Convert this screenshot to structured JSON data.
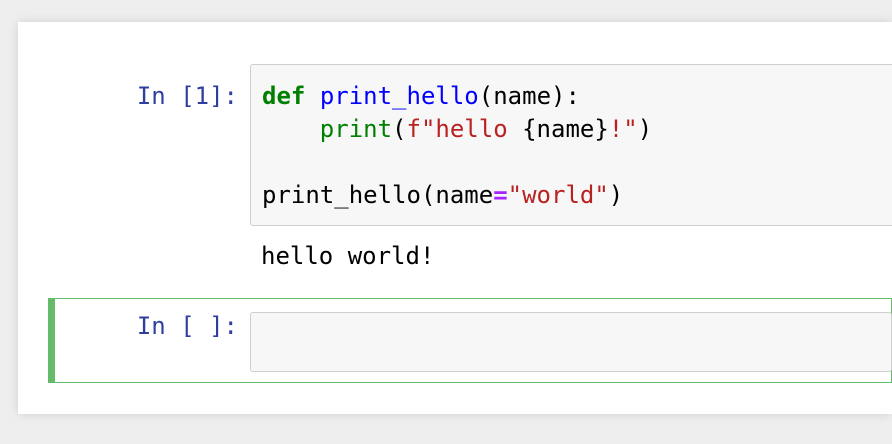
{
  "cells": [
    {
      "prompt": "In [1]:",
      "code": {
        "line1": {
          "kw": "def",
          "sp": " ",
          "fn": "print_hello",
          "rest": "(name):"
        },
        "line2": {
          "indent": "    ",
          "bi": "print",
          "open": "(",
          "str_a": "f\"hello ",
          "interp": "{name}",
          "str_b": "!\"",
          "close": ")"
        },
        "line4": {
          "call": "print_hello(name",
          "op": "=",
          "str": "\"world\"",
          "close": ")"
        }
      },
      "output": "hello world!"
    },
    {
      "prompt": "In [ ]:",
      "code_value": ""
    }
  ],
  "colors": {
    "prompt": "#303f9f",
    "selected_border": "#66bb6a",
    "keyword": "#008000",
    "function": "#0000ff",
    "string": "#ba2121",
    "operator": "#aa22ff"
  }
}
